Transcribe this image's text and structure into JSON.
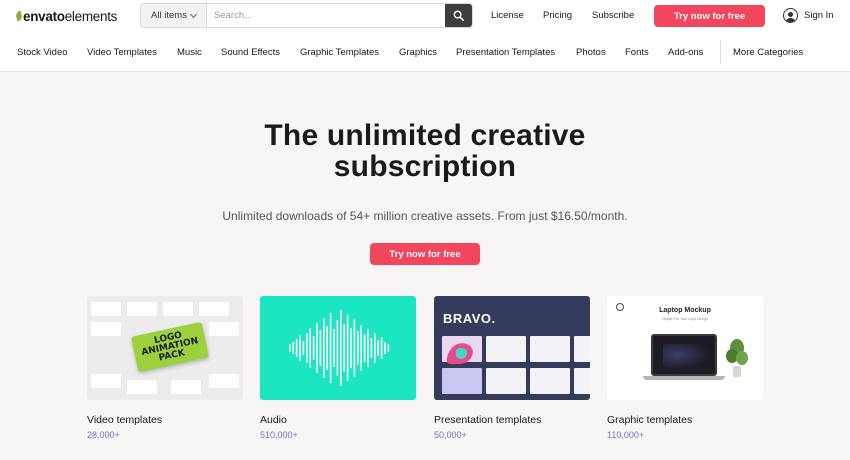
{
  "brand": {
    "logo_strong": "envato",
    "logo_light": "elements",
    "accent": "#82b541"
  },
  "search": {
    "filter_label": "All items",
    "placeholder": "Search...",
    "value": ""
  },
  "top_nav": {
    "license": "License",
    "pricing": "Pricing",
    "subscribe": "Subscribe",
    "cta": "Try now for free",
    "signin": "Sign In"
  },
  "categories": [
    "Stock Video",
    "Video Templates",
    "Music",
    "Sound Effects",
    "Graphic Templates",
    "Graphics",
    "Presentation Templates",
    "Photos",
    "Fonts",
    "Add-ons"
  ],
  "more_categories": "More Categories",
  "hero": {
    "title_line1": "The unlimited creative",
    "title_line2": "subscription",
    "subtitle": "Unlimited downloads of 54+ million creative assets. From just $16.50/month.",
    "cta": "Try now for free"
  },
  "thumbs": {
    "video": {
      "pack_line1": "LOGO",
      "pack_line2": "ANIMATION",
      "pack_line3": "PACK"
    },
    "presentation": {
      "heading": "BRAVO."
    },
    "graphic": {
      "heading": "Laptop Mockup",
      "subheading": "Simple For Your Logo Design"
    }
  },
  "cards": [
    {
      "label": "Video templates",
      "count": "28,000+"
    },
    {
      "label": "Audio",
      "count": "510,000+"
    },
    {
      "label": "Presentation templates",
      "count": "50,000+"
    },
    {
      "label": "Graphic templates",
      "count": "110,000+"
    }
  ],
  "colors": {
    "cta": "#f2465f",
    "count": "#7a6fd0",
    "audio_bg": "#1ce6c2",
    "presentation_bg": "#343b5c"
  }
}
